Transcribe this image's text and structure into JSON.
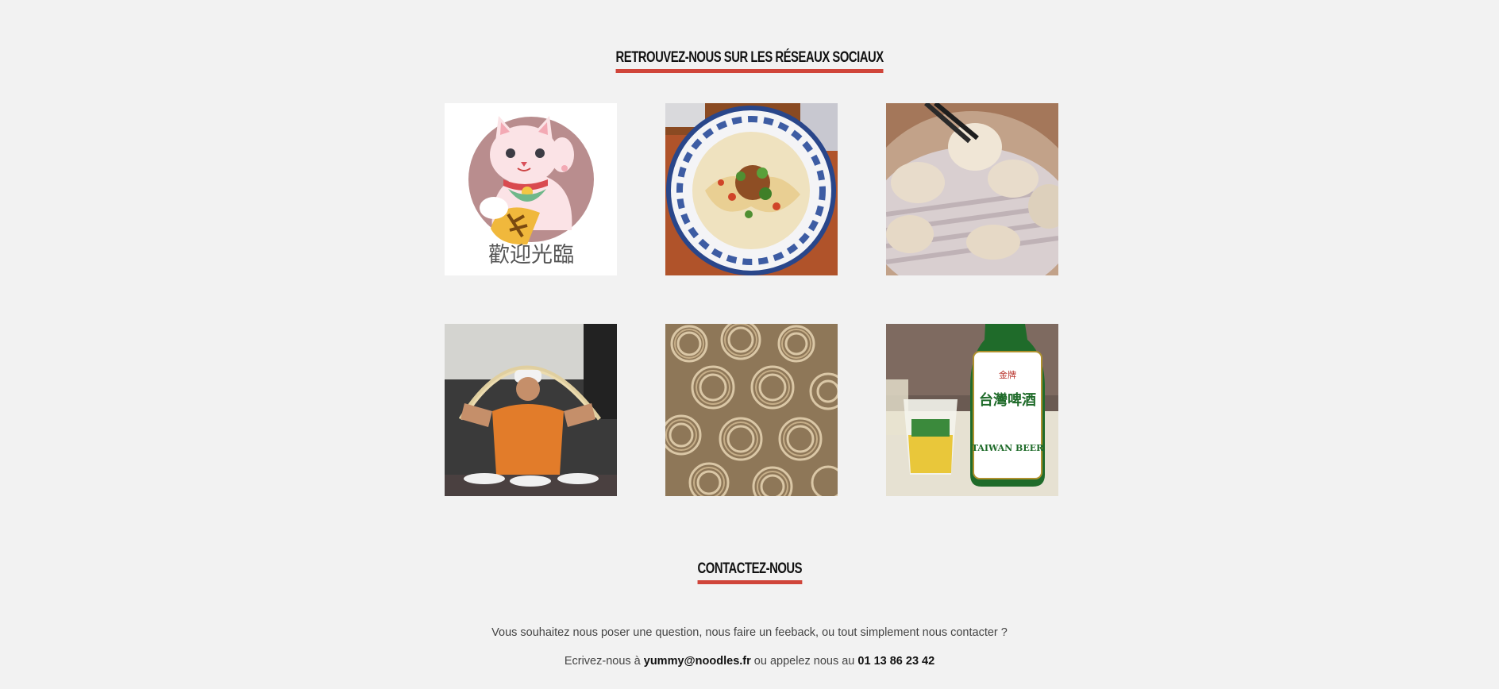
{
  "social": {
    "title": "Retrouvez-nous sur les réseaux sociaux",
    "images": [
      {
        "subject": "maneki-neko",
        "caption_text": "歡迎光臨"
      },
      {
        "subject": "noodle-bowl"
      },
      {
        "subject": "dumplings"
      },
      {
        "subject": "noodle-chef"
      },
      {
        "subject": "raw-noodles"
      },
      {
        "subject": "taiwan-beer",
        "bottle_text": "台灣啤酒",
        "bottle_brand": "TAIWAN BEER",
        "bottle_top": "金牌"
      }
    ]
  },
  "contact": {
    "title": "Contactez-nous",
    "line1": "Vous souhaitez nous poser une question, nous faire un feeback, ou tout simplement nous contacter ?",
    "line2_prefix": "Ecrivez-nous à",
    "email": "yummy@noodles.fr",
    "line2_middle": "ou appelez nous au",
    "phone": "01 13 86 23 42"
  },
  "colors": {
    "background": "#f2f2f2",
    "accent_underline": "#d0453a",
    "text": "#444444"
  }
}
